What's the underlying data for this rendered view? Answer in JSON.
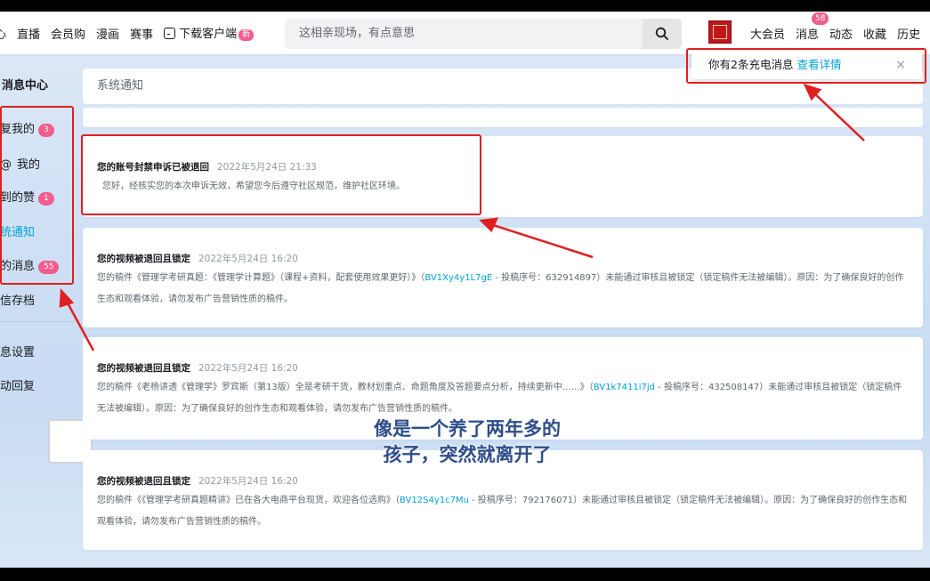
{
  "nav": {
    "items": [
      "心",
      "直播",
      "会员购",
      "漫画",
      "赛事"
    ],
    "download": "下载客户端",
    "download_badge": "新"
  },
  "search": {
    "placeholder": "这相亲现场，有点意思"
  },
  "right_nav": {
    "vip": "大会员",
    "messages": "消息",
    "messages_count": "58",
    "dynamic": "动态",
    "favorites": "收藏",
    "history": "历史"
  },
  "popup": {
    "text": "你有2条充电消息",
    "link": "查看详情",
    "close": "×"
  },
  "sidebar": {
    "header": "消息中心",
    "items": [
      {
        "label": "复我的",
        "badge": "3"
      },
      {
        "label": "我的",
        "badge": ""
      },
      {
        "label": "到的赞",
        "badge": "1"
      },
      {
        "label": "统通知",
        "badge": ""
      },
      {
        "label": "的消息",
        "badge": "55"
      },
      {
        "label": "信存档",
        "badge": ""
      },
      {
        "label": "息设置",
        "badge": ""
      },
      {
        "label": "动回复",
        "badge": ""
      }
    ]
  },
  "main": {
    "title": "系统通知",
    "cards": [
      {
        "title": "您的账号封禁申诉已被退回",
        "time": "2022年5月24日 21:33",
        "body": "您好，经核实您的本次申诉无效，希望您今后遵守社区规范，维护社区环境。"
      },
      {
        "title": "您的视频被退回且锁定",
        "time": "2022年5月24日 16:20",
        "body_pre": "您的稿件《管理学考研真题：《管理学计算题》（课程+资料，配套使用效果更好）》（",
        "bv": "BV1Xy4y1L7gE",
        "body_post": " - 投稿序号：632914897）未能通过审核且被锁定（锁定稿件无法被编辑）。原因：为了确保良好的创作生态和观看体验，请勿发布广告营销性质的稿件。"
      },
      {
        "title": "您的视频被退回且锁定",
        "time": "2022年5月24日 16:20",
        "body_pre": "您的稿件《老杨讲透《管理学》罗宾斯（第13版）全是考研干货，教材划重点、命题角度及答题要点分析，持续更新中……》（",
        "bv": "BV1k7411i7jd",
        "body_post": " - 投稿序号：432508147）未能通过审核且被锁定（锁定稿件无法被编辑）。原因：为了确保良好的创作生态和观看体验，请勿发布广告营销性质的稿件。"
      },
      {
        "title": "您的视频被退回且锁定",
        "time": "2022年5月24日 16:20",
        "body_pre": "您的稿件《《管理学考研真题精讲》已在各大电商平台现货，欢迎各位选购》（",
        "bv": "BV12S4y1c7Mu",
        "body_post": " - 投稿序号：792176071）未能通过审核且被锁定（锁定稿件无法被编辑）。原因：为了确保良好的创作生态和观看体验，请勿发布广告营销性质的稿件。"
      }
    ]
  },
  "caption": "像是一个养了两年多的孩子，突然就离开了",
  "colors": {
    "accent": "#00a1d6",
    "badge": "#f25d8e",
    "annotation": "#e02020"
  }
}
